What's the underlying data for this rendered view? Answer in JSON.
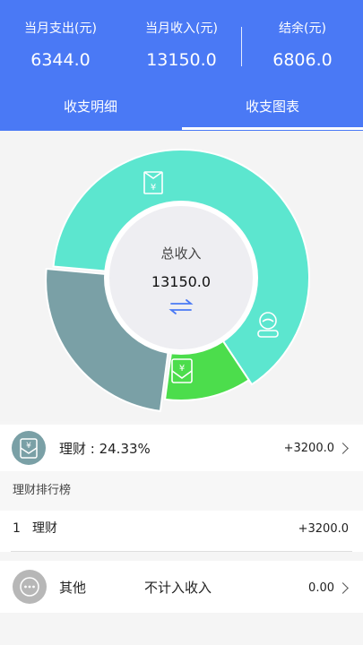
{
  "header": {
    "expense_label": "当月支出(元)",
    "expense_value": "6344.0",
    "income_label": "当月收入(元)",
    "income_value": "13150.0",
    "balance_label": "结余(元)",
    "balance_value": "6806.0"
  },
  "tabs": [
    {
      "label": "收支明细",
      "active": false
    },
    {
      "label": "收支图表",
      "active": true
    }
  ],
  "chart_data": {
    "type": "pie",
    "center_title": "总收入",
    "center_value": "13150.0",
    "slices": [
      {
        "category": "工资",
        "percent": 64.3,
        "color": "#5ce6cf",
        "icon": "salary-envelope-icon"
      },
      {
        "category": "其他",
        "percent": 11.4,
        "color": "#4cdd4c",
        "icon": "other-icon"
      },
      {
        "category": "理财",
        "percent": 24.33,
        "color": "#7aa0a6",
        "icon": "finance-icon"
      }
    ]
  },
  "selected": {
    "label": "理财 : 24.33%",
    "amount": "+3200.0",
    "icon_color": "#7aa0a6"
  },
  "ranking": {
    "title": "理财排行榜",
    "items": [
      {
        "rank": "1",
        "name": "理财",
        "amount": "+3200.0"
      }
    ]
  },
  "other": {
    "label": "其他",
    "note": "不计入收入",
    "amount": "0.00"
  },
  "colors": {
    "header_bg": "#4a79f5",
    "swap_icon": "#4a79f5"
  }
}
